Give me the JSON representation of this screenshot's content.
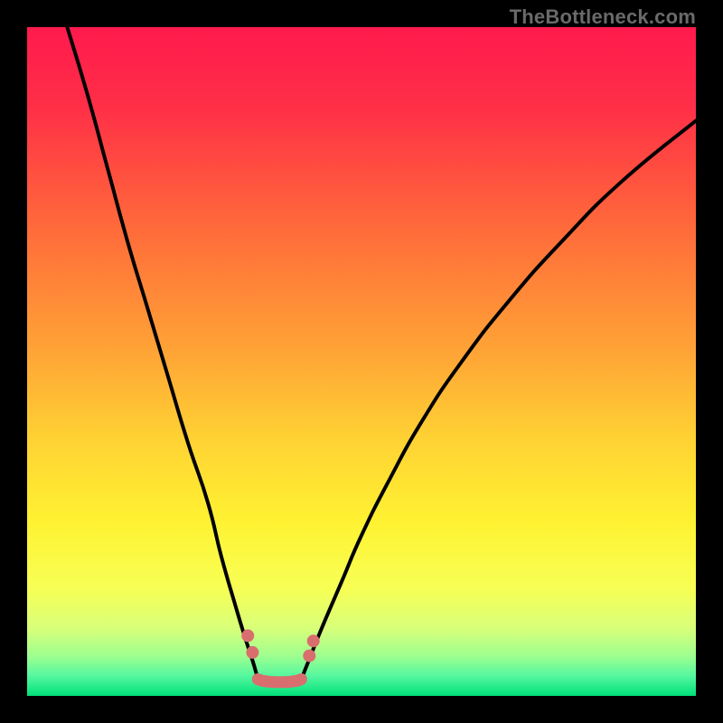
{
  "watermark": "TheBottleneck.com",
  "colors": {
    "frame": "#000000",
    "gradient_top": "#ff1a4d",
    "gradient_mid": "#ffd333",
    "gradient_bottom": "#00e07a",
    "curve_line": "#000000",
    "curve_dots": "#d96e6e",
    "curve_bridge": "#d96e6e"
  },
  "chart_data": {
    "type": "line",
    "title": "",
    "xlabel": "",
    "ylabel": "",
    "xlim": [
      0,
      100
    ],
    "ylim": [
      0,
      100
    ],
    "grid": false,
    "series": [
      {
        "name": "left-branch",
        "x": [
          6,
          9,
          12,
          15,
          18,
          21,
          24,
          27,
          29,
          31,
          32.5,
          33.8,
          34.5
        ],
        "y": [
          100,
          90,
          79,
          68,
          58,
          48,
          38,
          29,
          21,
          14,
          9,
          5,
          2.5
        ]
      },
      {
        "name": "right-branch",
        "x": [
          41,
          42,
          44,
          47,
          50,
          54,
          59,
          65,
          72,
          80,
          89,
          100
        ],
        "y": [
          2.5,
          5,
          10,
          17,
          24,
          32,
          41,
          50,
          59,
          68,
          77,
          86
        ]
      }
    ],
    "bottom_bridge": {
      "x0": 34.5,
      "x1": 41,
      "y": 2.5
    },
    "dot_groups": [
      {
        "cx": 33.0,
        "cy": 9.0
      },
      {
        "cx": 33.7,
        "cy": 6.5
      },
      {
        "cx": 42.2,
        "cy": 6.0
      },
      {
        "cx": 42.8,
        "cy": 8.2
      }
    ]
  }
}
